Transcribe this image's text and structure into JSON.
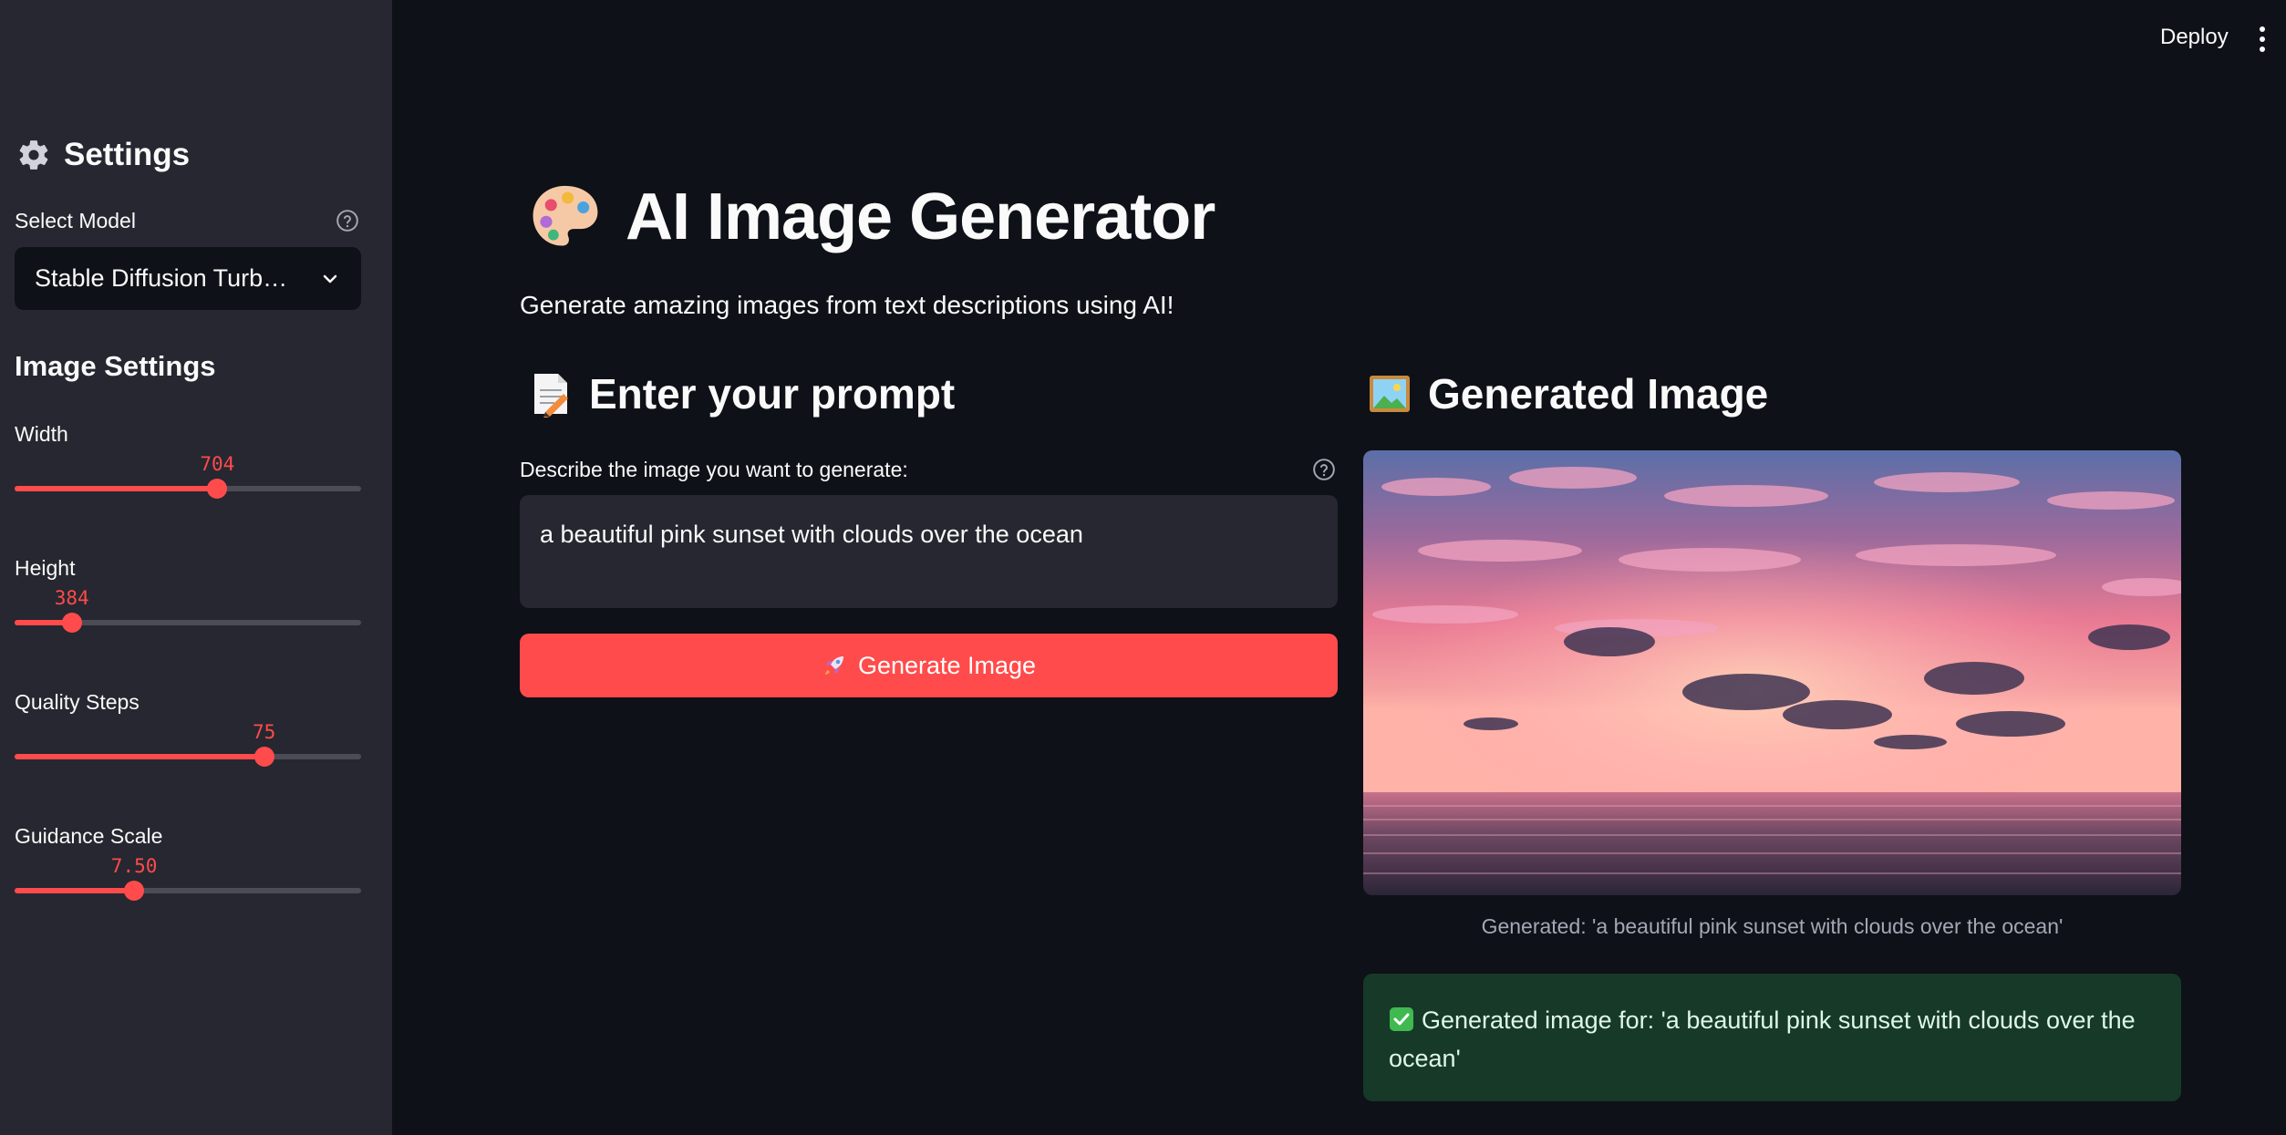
{
  "header": {
    "deploy_label": "Deploy"
  },
  "sidebar": {
    "title": "Settings",
    "model_label": "Select Model",
    "model_value": "Stable Diffusion Turb…",
    "image_settings_heading": "Image Settings",
    "sliders": [
      {
        "label": "Width",
        "value": "704",
        "fraction": 0.585
      },
      {
        "label": "Height",
        "value": "384",
        "fraction": 0.165
      },
      {
        "label": "Quality Steps",
        "value": "75",
        "fraction": 0.72
      },
      {
        "label": "Guidance Scale",
        "value": "7.50",
        "fraction": 0.345
      }
    ]
  },
  "main": {
    "title": "AI Image Generator",
    "subtitle": "Generate amazing images from text descriptions using AI!",
    "prompt_heading": "Enter your prompt",
    "prompt_label": "Describe the image you want to generate:",
    "prompt_value": "a beautiful pink sunset with clouds over the ocean",
    "generate_button": "Generate Image",
    "image_heading": "Generated Image",
    "caption": "Generated: 'a beautiful pink sunset with clouds over the ocean'",
    "success_message": "Generated image for: 'a beautiful pink sunset with clouds over the ocean'"
  },
  "colors": {
    "accent": "#ff4b4b",
    "background": "#0e1117",
    "sidebar": "#262730",
    "success_bg": "#173928"
  }
}
